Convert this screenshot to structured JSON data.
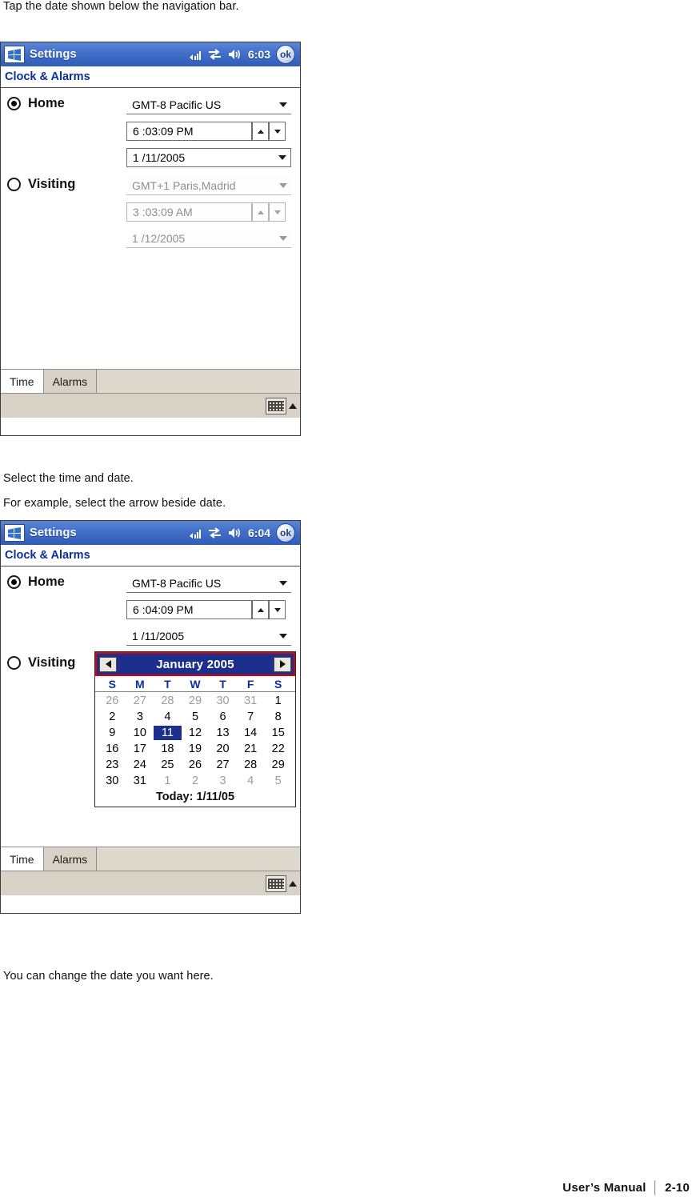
{
  "instructions": {
    "line1": "Tap the date shown below the navigation bar.",
    "line2": "Select the time and date.",
    "line3": "For example, select the arrow beside date.",
    "line4": "You can change the date you want here."
  },
  "footer": {
    "manual": "User’s Manual",
    "separator": "│",
    "page": "2-10"
  },
  "screens": [
    {
      "titlebar": {
        "start_icon": "windows-flag-icon",
        "title": "Settings",
        "signal_icon": "signal-bars-icon",
        "connect_icon": "connectivity-icon",
        "volume_icon": "speaker-icon",
        "clock": "6:03",
        "ok_label": "ok"
      },
      "page_title": "Clock & Alarms",
      "home": {
        "label": "Home",
        "selected": true,
        "timezone": "GMT-8 Pacific US",
        "time": "6 :03:09 PM",
        "date": "1 /11/2005"
      },
      "visiting": {
        "label": "Visiting",
        "selected": false,
        "timezone": "GMT+1 Paris,Madrid",
        "time": "3 :03:09 AM",
        "date": "1 /12/2005"
      },
      "tabs": [
        {
          "label": "Time",
          "active": true
        },
        {
          "label": "Alarms",
          "active": false
        }
      ],
      "sip": {
        "keyboard_icon": "keyboard-icon",
        "caret_icon": "caret-up-icon"
      }
    },
    {
      "titlebar": {
        "start_icon": "windows-flag-icon",
        "title": "Settings",
        "signal_icon": "signal-bars-icon",
        "connect_icon": "connectivity-icon",
        "volume_icon": "speaker-icon",
        "clock": "6:04",
        "ok_label": "ok"
      },
      "page_title": "Clock & Alarms",
      "home": {
        "label": "Home",
        "selected": true,
        "timezone": "GMT-8 Pacific US",
        "time": "6 :04:09 PM",
        "date": "1 /11/2005"
      },
      "visiting": {
        "label": "Visiting",
        "selected": false
      },
      "calendar": {
        "prev_icon": "arrow-left-icon",
        "next_icon": "arrow-right-icon",
        "title": "January 2005",
        "dow": [
          "S",
          "M",
          "T",
          "W",
          "T",
          "F",
          "S"
        ],
        "weeks": [
          [
            {
              "d": "26",
              "other": true
            },
            {
              "d": "27",
              "other": true
            },
            {
              "d": "28",
              "other": true
            },
            {
              "d": "29",
              "other": true
            },
            {
              "d": "30",
              "other": true
            },
            {
              "d": "31",
              "other": true
            },
            {
              "d": "1",
              "other": false
            }
          ],
          [
            {
              "d": "2"
            },
            {
              "d": "3"
            },
            {
              "d": "4"
            },
            {
              "d": "5"
            },
            {
              "d": "6"
            },
            {
              "d": "7"
            },
            {
              "d": "8"
            }
          ],
          [
            {
              "d": "9"
            },
            {
              "d": "10"
            },
            {
              "d": "11",
              "selected": true
            },
            {
              "d": "12"
            },
            {
              "d": "13"
            },
            {
              "d": "14"
            },
            {
              "d": "15"
            }
          ],
          [
            {
              "d": "16"
            },
            {
              "d": "17"
            },
            {
              "d": "18"
            },
            {
              "d": "19"
            },
            {
              "d": "20"
            },
            {
              "d": "21"
            },
            {
              "d": "22"
            }
          ],
          [
            {
              "d": "23"
            },
            {
              "d": "24"
            },
            {
              "d": "25"
            },
            {
              "d": "26"
            },
            {
              "d": "27"
            },
            {
              "d": "28"
            },
            {
              "d": "29"
            }
          ],
          [
            {
              "d": "30"
            },
            {
              "d": "31"
            },
            {
              "d": "1",
              "other": true
            },
            {
              "d": "2",
              "other": true
            },
            {
              "d": "3",
              "other": true
            },
            {
              "d": "4",
              "other": true
            },
            {
              "d": "5",
              "other": true
            }
          ]
        ],
        "today": "Today: 1/11/05",
        "highlight_color": "#e00000",
        "header_color": "#1c2f8c"
      },
      "tabs": [
        {
          "label": "Time",
          "active": true
        },
        {
          "label": "Alarms",
          "active": false
        }
      ],
      "sip": {
        "keyboard_icon": "keyboard-icon",
        "caret_icon": "caret-up-icon"
      }
    }
  ]
}
